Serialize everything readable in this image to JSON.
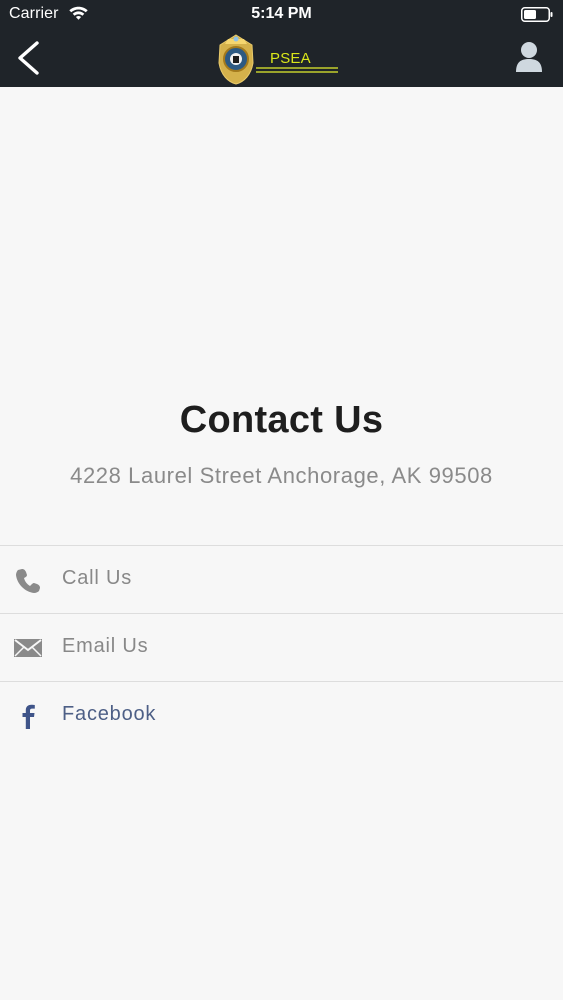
{
  "status_bar": {
    "carrier": "Carrier",
    "time": "5:14 PM"
  },
  "navbar": {
    "back_icon": "chevron-left-icon",
    "logo_title": "PSEA",
    "profile_icon": "user-icon"
  },
  "contact": {
    "title": "Contact Us",
    "address": "4228 Laurel Street Anchorage, AK 99508",
    "rows": [
      {
        "label": "Call Us",
        "icon": "phone-icon",
        "color": "#888888"
      },
      {
        "label": "Email Us",
        "icon": "envelope-icon",
        "color": "#888888"
      },
      {
        "label": "Facebook",
        "icon": "facebook-icon",
        "color": "#4d5f86"
      }
    ]
  },
  "colors": {
    "header": "#1f2429",
    "background": "#f7f7f7",
    "accent_logo": "#d9e61a"
  }
}
